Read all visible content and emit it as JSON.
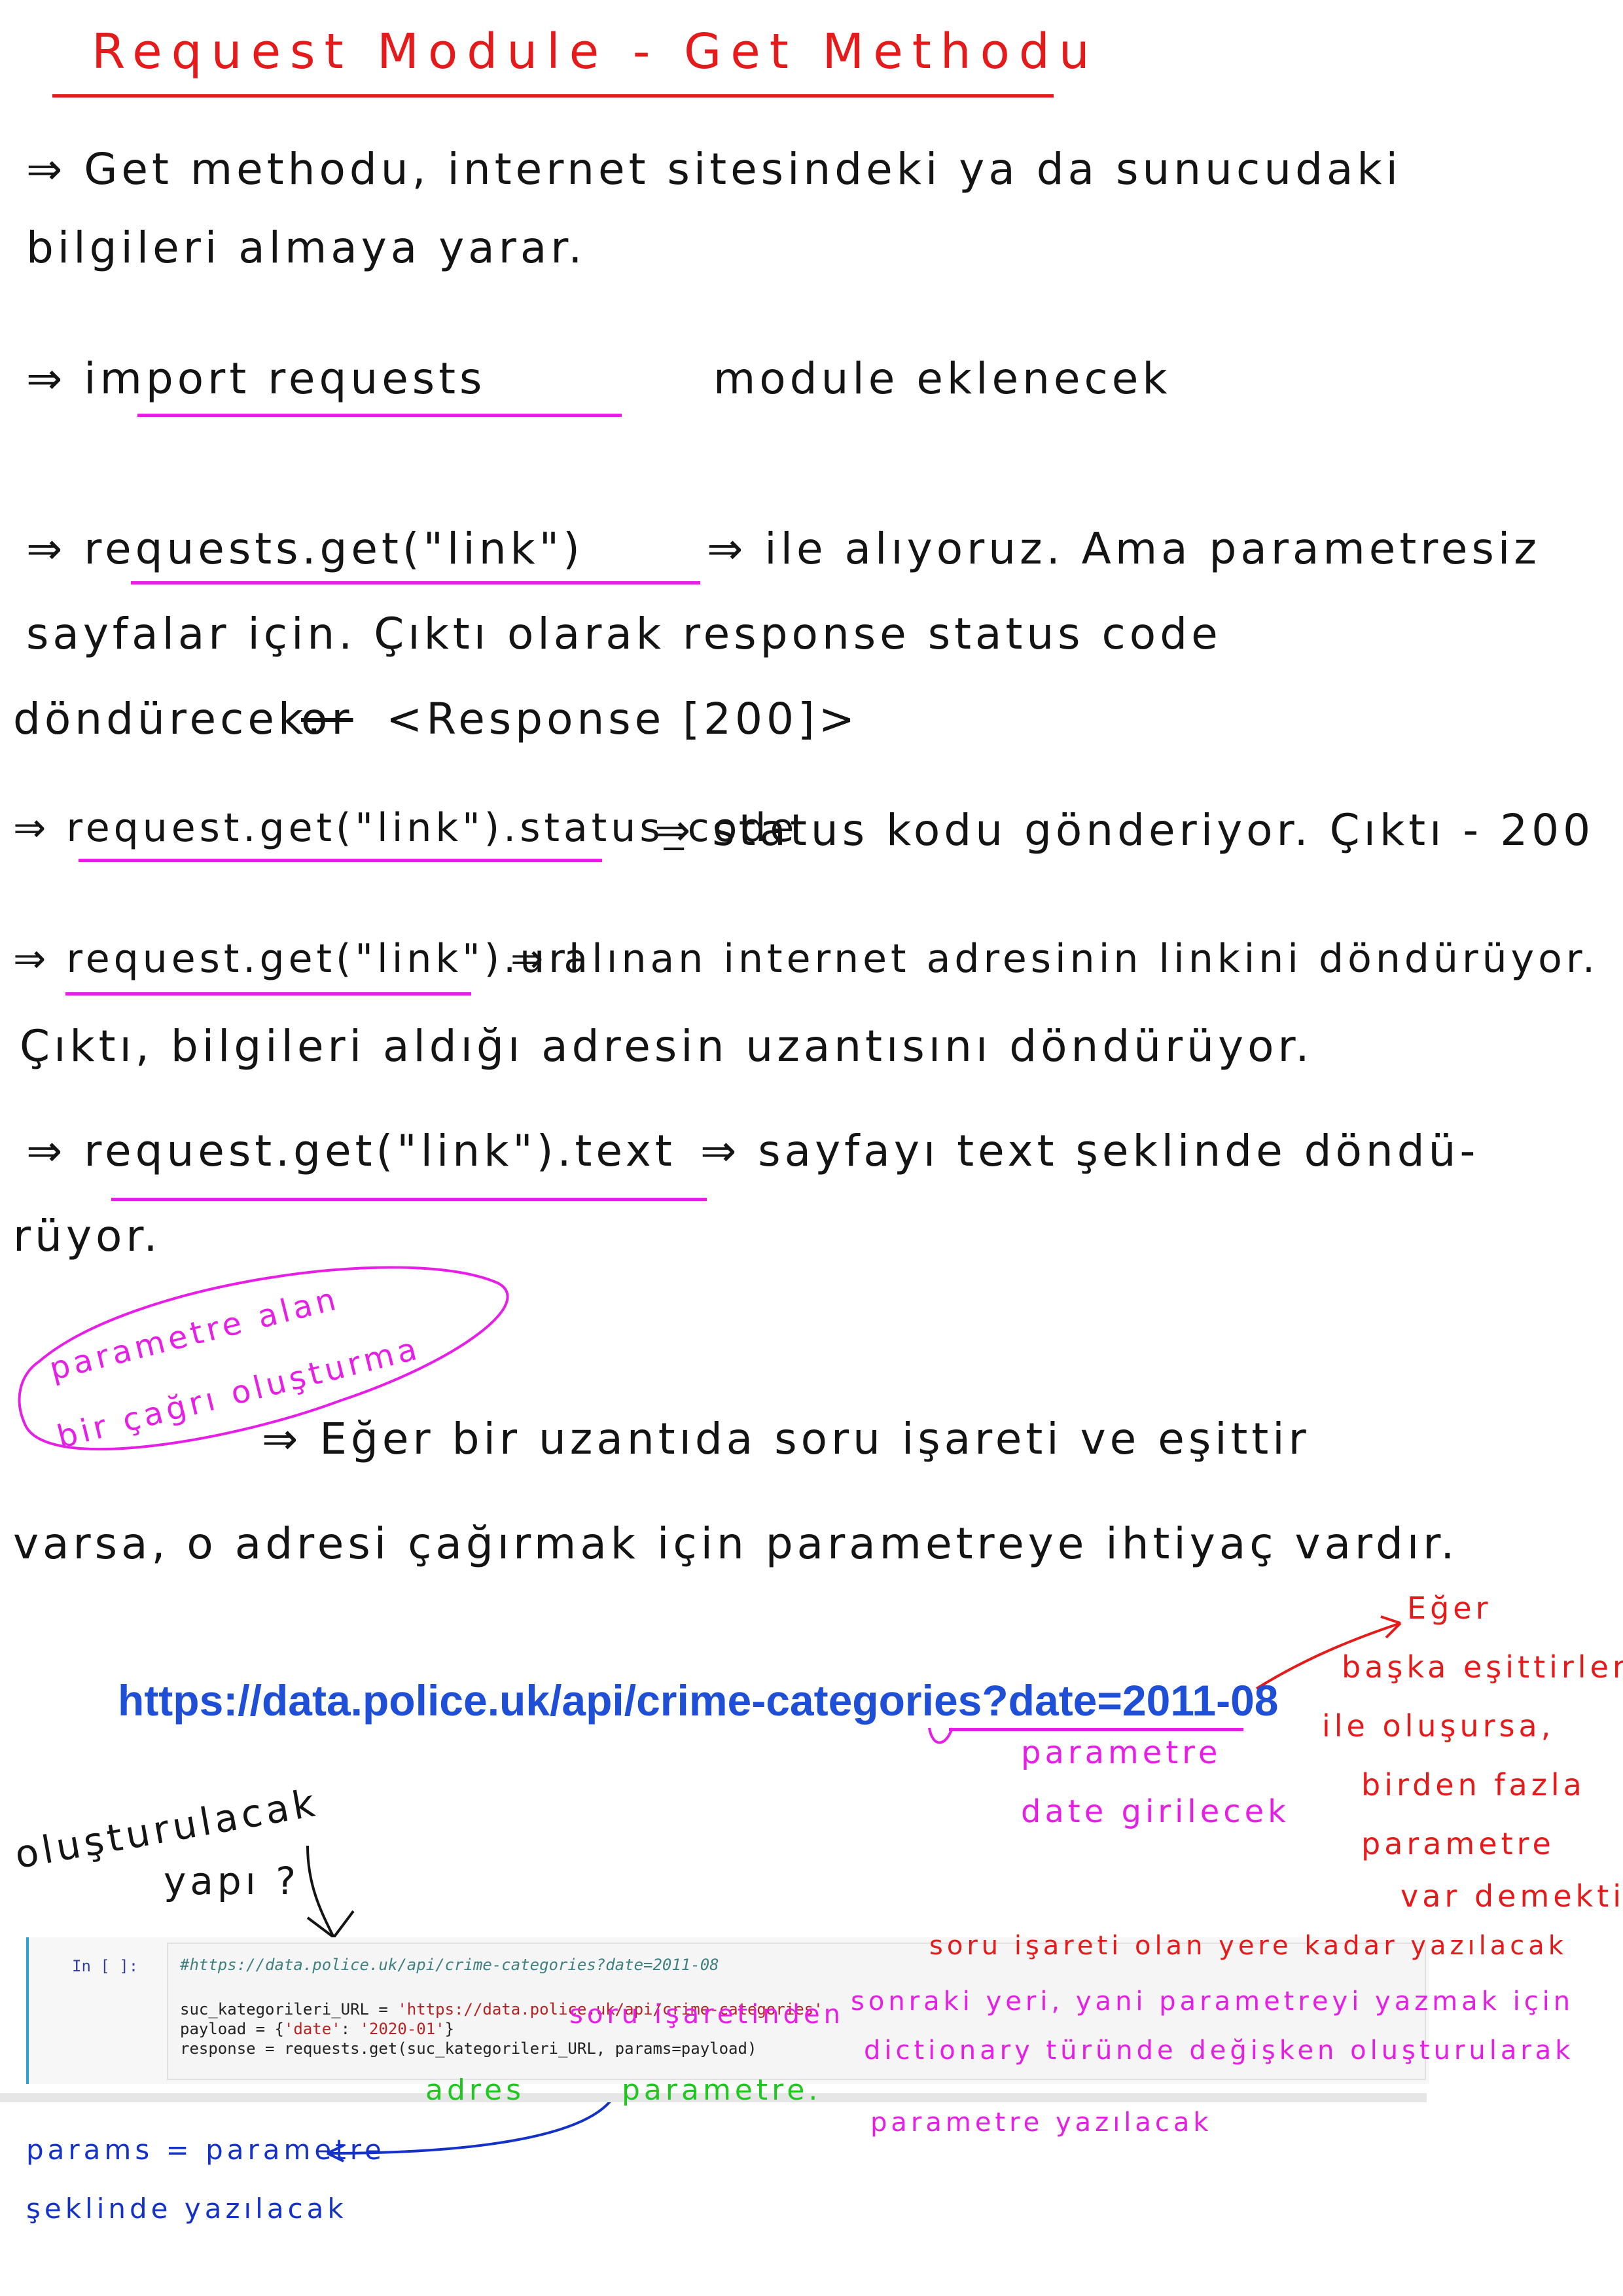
{
  "title": "Request Module - Get Methodu",
  "notes": {
    "get_intro_1": "⇒ Get methodu, internet sitesindeki ya da sunucudaki",
    "get_intro_2": "bilgileri almaya yarar.",
    "import_code": "⇒ import requests",
    "import_rest": "module eklenecek",
    "get_code": "⇒ requests.get(\"link\")",
    "get_rest": "⇒ ile alıyoruz. Ama parametresiz",
    "get_line2": "sayfalar için. Çıktı olarak response status code",
    "get_line3_a": "döndürecek.",
    "get_line3_struck": "or",
    "get_line3_b": "<Response [200]>",
    "status_code": "⇒ request.get(\"link\").status_code",
    "status_rest": "⇒ status kodu gönderiyor. Çıktı - 200",
    "url_code": "⇒ request.get(\"link\").url",
    "url_rest": "⇒ alınan internet adresinin linkini döndürüyor.",
    "url_line2": "Çıktı, bilgileri aldığı adresin uzantısını döndürüyor.",
    "text_code": "⇒ request.get(\"link\").text",
    "text_rest": "⇒ sayfayı text şeklinde döndü-",
    "text_line2": "rüyor.",
    "bubble_line1": "parametre alan",
    "bubble_line2": "bir çağrı oluşturma",
    "eger_line1": "⇒ Eğer bir uzantıda soru işareti ve eşittir",
    "eger_line2": "varsa, o adresi çağırmak için parametreye ihtiyaç vardır."
  },
  "example_url": "https://data.police.uk/api/crime-categories?date=2011-08",
  "url_notes": {
    "param_label_1": "parametre",
    "param_label_2": "date girilecek",
    "side_1": "Eğer",
    "side_2": "başka eşittirler",
    "side_3": "ile oluşursa,",
    "side_4": "birden fazla",
    "side_5": "parametre",
    "side_6": "var demektir."
  },
  "structure_label_1": "oluşturulacak",
  "structure_label_2": "yapı ?",
  "notebook": {
    "prompt": "In [ ]:",
    "line_comment": "#https://data.police.uk/api/crime-categories?date=2011-08",
    "line_url_var": "suc_kategorileri_URL = ",
    "line_url_str": "'https://data.police.uk/api/crime-categories'",
    "line_payload_a": "payload = {",
    "line_payload_key": "'date'",
    "line_payload_mid": ": ",
    "line_payload_val": "'2020-01'",
    "line_payload_b": "}",
    "line_resp": "response = requests.get(suc_kategorileri_URL, params=payload)"
  },
  "code_notes": {
    "red_note": "soru işareti olan yere kadar yazılacak",
    "mag_1": "soru işaretinden",
    "mag_2": "sonraki yeri, yani parametreyi yazmak için",
    "mag_3": "dictionary türünde değişken oluşturularak",
    "mag_4": "parametre yazılacak",
    "green_adres": "adres",
    "green_param": "parametre.",
    "blue_1": "params = parametre",
    "blue_2": "şeklinde yazılacak"
  },
  "colors": {
    "ink": "#141414",
    "red": "#e51a1a",
    "magenta": "#e61ee6",
    "green": "#1ec81e",
    "blue": "#1432c8",
    "link": "#1f4fd6"
  }
}
